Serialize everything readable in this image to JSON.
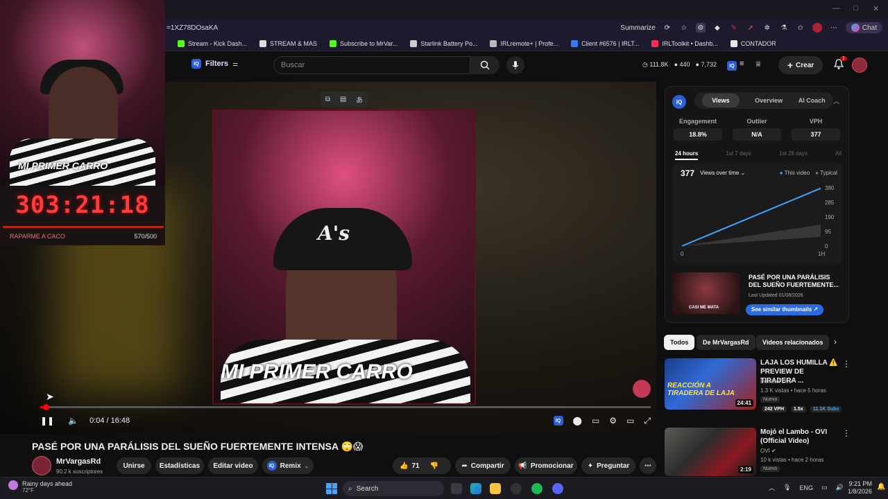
{
  "browser": {
    "url": "=1XZ78DOsaKA",
    "summarize_label": "Summarize",
    "copilot_label": "Chat",
    "bookmarks": [
      {
        "label": "Stream - Kick Dash...",
        "color": "#53fc18"
      },
      {
        "label": "STREAM & MAS",
        "color": "#dddddd"
      },
      {
        "label": "Subscribe to MrVar...",
        "color": "#53fc18"
      },
      {
        "label": "Starlink Battery Po...",
        "color": "#cccccc"
      },
      {
        "label": "IRLremote+ | Profe...",
        "color": "#bbbbbb"
      },
      {
        "label": "Client #6576 | IRLT...",
        "color": "#3a78ff"
      },
      {
        "label": "IRLToolkit • Dashb...",
        "color": "#ff2a55"
      },
      {
        "label": "CONTADOR",
        "color": "#e8e8e8"
      }
    ]
  },
  "header": {
    "filters_label": "Filters",
    "search_placeholder": "Buscar",
    "stats": [
      "111.8K",
      "440",
      "7,732"
    ],
    "crear_label": "Crear",
    "notif_count": "1"
  },
  "overlay": {
    "cam_label": "MI PRIMER CARRO",
    "timer": "303:21:18",
    "goal_label": "RAPARME A CACO",
    "goal_count": "570/500",
    "goal_progress": 1.0
  },
  "player": {
    "inner_label": "MI PRIMER CARRO",
    "cap_logo": "A's",
    "time": "0:04 / 16:48",
    "progress": 0.004
  },
  "video": {
    "title": "PASÉ POR UNA PARÁLISIS DEL SUEÑO FUERTEMENTE INTENSA 🙄😱",
    "channel": "MrVargasRd",
    "subs": "90.2 k suscriptores",
    "buttons": {
      "unirse": "Unirse",
      "estadisticas": "Estadísticas",
      "editar": "Editar video",
      "remix": "Remix",
      "likes": "71",
      "compartir": "Compartir",
      "promocionar": "Promocionar",
      "preguntar": "Preguntar"
    }
  },
  "iq": {
    "tabs": [
      "Views",
      "Overview",
      "AI Coach"
    ],
    "metrics": [
      {
        "label": "Engagement",
        "value": "18.8%"
      },
      {
        "label": "Outlier",
        "value": "N/A"
      },
      {
        "label": "VPH",
        "value": "377"
      }
    ],
    "ranges": [
      "24 hours",
      "1st 7 days",
      "1st 28 days",
      "All"
    ],
    "chart_value": "377",
    "chart_selector": "Views over time",
    "legend": [
      "This video",
      "Typical"
    ],
    "thumb_title": "PASÉ POR UNA PARÁLISIS DEL SUEÑO FUERTEMENTE...",
    "thumb_updated": "Last Updated 01/08/2026",
    "similar_label": "See similar thumbnails",
    "thumb_caption": "CASI ME MATA"
  },
  "chart_data": {
    "type": "line",
    "x_ticks": [
      "0",
      "1H"
    ],
    "y_ticks": [
      "380",
      "285",
      "190",
      "95",
      "0"
    ],
    "ylim": [
      0,
      380
    ],
    "series": [
      {
        "name": "This video",
        "x": [
          0,
          1
        ],
        "y": [
          0,
          377
        ],
        "color": "#3ea6ff"
      },
      {
        "name": "Typical",
        "x": [
          0,
          1
        ],
        "y_low": [
          0,
          60
        ],
        "y_high": [
          0,
          140
        ],
        "color": "#555555"
      }
    ]
  },
  "chips": [
    "Todos",
    "De MrVargasRd",
    "Videos relacionados"
  ],
  "recs": [
    {
      "title": "LAJA LOS HUMILLA ⚠️ PREVIEW DE TIRADERA ...",
      "channel": "Domiilol Live",
      "meta": "1.3 K vistas • hace 5 horas",
      "badge": "Nuevo",
      "duration": "24:41",
      "thumb_text": "REACCIÓN A TIRADERA DE LAJA",
      "tags": [
        "242 VPH",
        "1.5x",
        "11.1K Subs"
      ]
    },
    {
      "title": "Mojó el Lambo - OVI (Official Video)",
      "channel": "OVI",
      "meta": "10 k vistas • hace 2 horas",
      "badge": "Nuevo",
      "duration": "2:19",
      "thumb_text": "",
      "tags": []
    }
  ],
  "taskbar": {
    "weather": "Rainy days ahead",
    "temp": "72°F",
    "search_label": "Search",
    "lang": "ENG",
    "time": "9:21 PM",
    "date": "1/8/2026"
  }
}
